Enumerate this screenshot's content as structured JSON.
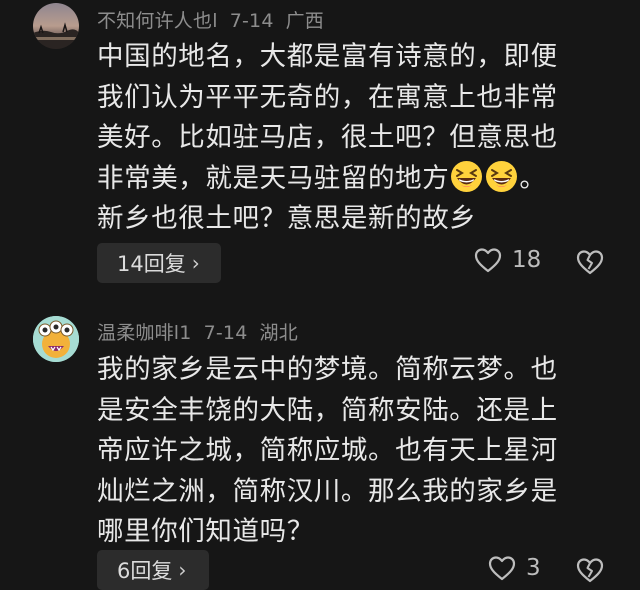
{
  "comments": [
    {
      "username": "不知何许人也l",
      "date": "7-14",
      "location": "广西",
      "avatar_icon": "sunset-photo-avatar",
      "lines": [
        "中国的地名，大都是富有诗意的，即便",
        "我们认为平平无奇的，在寓意上也非常",
        "美好。比如驻马店，很土吧？但意思也",
        "非常美，就是天马驻留的地方",
        "新乡也很土吧？意思是新的故乡"
      ],
      "line4_suffix": "。",
      "emoji_icon": "grinning-squinting-face-emoji",
      "reply_label": "14回复",
      "likes": "18"
    },
    {
      "username": "温柔咖啡l1",
      "date": "7-14",
      "location": "湖北",
      "avatar_icon": "cartoon-monster-avatar",
      "lines": [
        "我的家乡是云中的梦境。简称云梦。也",
        "是安全丰饶的大陆，简称安陆。还是上",
        "帝应许之城，简称应城。也有天上星河",
        "灿烂之洲，简称汉川。那么我的家乡是",
        "哪里你们知道吗？"
      ],
      "reply_label": "6回复",
      "likes": "3"
    }
  ],
  "colors": {
    "background": "#161616",
    "text": "#e8e8e8",
    "meta": "#8d8d8d",
    "reply_bg": "#2c2c2c"
  }
}
